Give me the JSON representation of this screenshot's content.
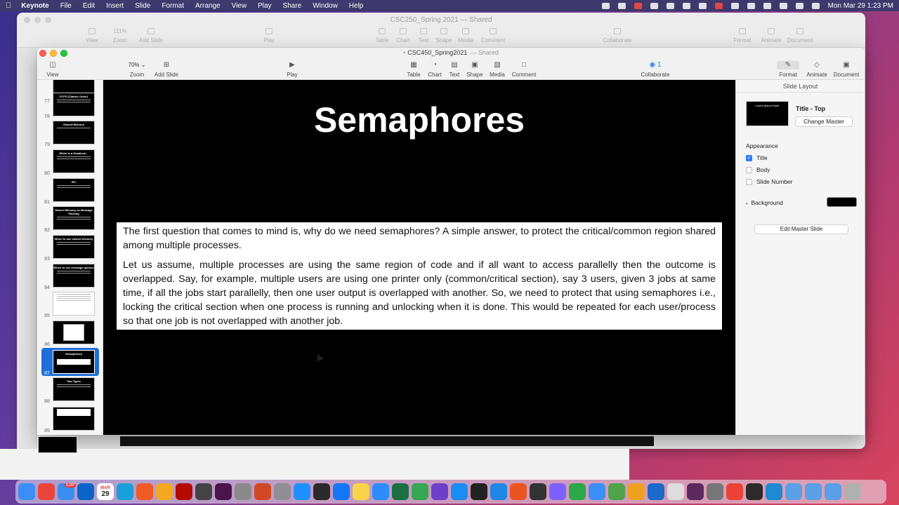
{
  "menubar": {
    "app_name": "Keynote",
    "items": [
      "File",
      "Edit",
      "Insert",
      "Slide",
      "Format",
      "Arrange",
      "View",
      "Play",
      "Share",
      "Window",
      "Help"
    ],
    "clock": "Mon Mar 29  1:23 PM"
  },
  "background_window": {
    "title": "CSC250_Spring 2021 — Shared",
    "toolbar": [
      "View",
      "Zoom",
      "Add Slide",
      "Play",
      "Table",
      "Chart",
      "Text",
      "Shape",
      "Media",
      "Comment",
      "Collaborate",
      "Format",
      "Animate",
      "Document"
    ],
    "zoom_value": "111%"
  },
  "window": {
    "title": "CSC450_Spring2021",
    "shared_label": "Shared",
    "toolbar": {
      "view": "View",
      "zoom_value": "70%",
      "zoom": "Zoom",
      "add_slide": "Add Slide",
      "play": "Play",
      "table": "Table",
      "chart": "Chart",
      "text": "Text",
      "shape": "Shape",
      "media": "Media",
      "comment": "Comment",
      "collab_count": "1",
      "collaborate": "Collaborate",
      "format": "Format",
      "animate": "Animate",
      "document": "Document"
    }
  },
  "navigator": {
    "slides": [
      {
        "number": "77",
        "title": ""
      },
      {
        "number": "78",
        "title": "FCFS (Classic Order)"
      },
      {
        "number": "79",
        "title": "Shared Memory"
      },
      {
        "number": "80",
        "title": "When is a Deadlock..."
      },
      {
        "number": "81",
        "title": "IPC"
      },
      {
        "number": "82",
        "title": "Shared Memory vs Message Passing"
      },
      {
        "number": "83",
        "title": "When to use shared memory"
      },
      {
        "number": "84",
        "title": "When to use message queues"
      },
      {
        "number": "85",
        "title": ""
      },
      {
        "number": "86",
        "title": ""
      },
      {
        "number": "87",
        "title": "Semaphores"
      },
      {
        "number": "88",
        "title": "Two Types"
      },
      {
        "number": "89",
        "title": ""
      }
    ],
    "selected_index": 10
  },
  "slide": {
    "title": "Semaphores",
    "paragraphs": [
      "The first question that comes to mind is, why do we need semaphores? A simple answer, to protect the critical/common region shared among multiple processes.",
      "Let us assume, multiple processes are using the same region of code and if all want to access parallelly then the outcome is overlapped. Say, for example, multiple users are using one printer only (common/critical section), say 3 users, given 3 jobs at same time, if all the jobs start parallelly, then one user output is overlapped with another. So, we need to protect that using semaphores i.e., locking the critical section when one process is running and unlocking when it is done. This would be repeated for each user/process so that one job is not overlapped with another job."
    ]
  },
  "inspector": {
    "header": "Slide Layout",
    "master_thumb_text": "Lorem Ipsum Dolor",
    "master_name": "Title - Top",
    "change_master": "Change Master",
    "appearance": "Appearance",
    "options": [
      {
        "label": "Title",
        "checked": true
      },
      {
        "label": "Body",
        "checked": false
      },
      {
        "label": "Slide Number",
        "checked": false
      }
    ],
    "background_label": "Background",
    "background_color": "#000000",
    "edit_master": "Edit Master Slide"
  },
  "colors": {
    "accent": "#2d7ff9",
    "selection": "#1f6fd8",
    "slide_bg": "#000000"
  },
  "dock": {
    "calendar_day": "29",
    "calendar_month": "MAR",
    "mail_badge": "1,147",
    "icons": [
      {
        "name": "finder",
        "color": "#3a8ef6"
      },
      {
        "name": "chrome",
        "color": "#e8453c"
      },
      {
        "name": "mail",
        "color": "#3b8ef0"
      },
      {
        "name": "outlook",
        "color": "#0a64c8"
      },
      {
        "name": "calendar",
        "color": "#ffffff"
      },
      {
        "name": "webex",
        "color": "#1aa0d8"
      },
      {
        "name": "brave",
        "color": "#f05a24"
      },
      {
        "name": "pages",
        "color": "#f5a623"
      },
      {
        "name": "acrobat",
        "color": "#b30b00"
      },
      {
        "name": "sublime",
        "color": "#444444"
      },
      {
        "name": "slack",
        "color": "#4a154b"
      },
      {
        "name": "launchpad",
        "color": "#8a8a8a"
      },
      {
        "name": "powerpoint",
        "color": "#d24726"
      },
      {
        "name": "settings",
        "color": "#8e8e93"
      },
      {
        "name": "safari",
        "color": "#1e90ff"
      },
      {
        "name": "epic-games",
        "color": "#2a2a2a"
      },
      {
        "name": "xcode",
        "color": "#1575f9"
      },
      {
        "name": "notes",
        "color": "#f7d44a"
      },
      {
        "name": "zoom",
        "color": "#2d8cff"
      },
      {
        "name": "excel",
        "color": "#1d6f42"
      },
      {
        "name": "chrome-2",
        "color": "#34a853"
      },
      {
        "name": "github",
        "color": "#6e40c9"
      },
      {
        "name": "app-store",
        "color": "#1c8cf5"
      },
      {
        "name": "terminal",
        "color": "#222222"
      },
      {
        "name": "windows",
        "color": "#1e88e5"
      },
      {
        "name": "ubuntu",
        "color": "#e95420"
      },
      {
        "name": "terminal-2",
        "color": "#333333"
      },
      {
        "name": "messenger",
        "color": "#7b61ff"
      },
      {
        "name": "numbers",
        "color": "#2aa84a"
      },
      {
        "name": "keynote",
        "color": "#3a8ef6"
      },
      {
        "name": "maps",
        "color": "#4fa34a"
      },
      {
        "name": "photos",
        "color": "#f0a020"
      },
      {
        "name": "sourcetree",
        "color": "#1b6ac9"
      },
      {
        "name": "textedit",
        "color": "#dddddd"
      },
      {
        "name": "slack-2",
        "color": "#5d2a5f"
      },
      {
        "name": "system-prefs",
        "color": "#777777"
      },
      {
        "name": "chrome-3",
        "color": "#ea4335"
      },
      {
        "name": "terminal-3",
        "color": "#2b2b2b"
      },
      {
        "name": "vscode",
        "color": "#1f8ad2"
      },
      {
        "name": "downloads",
        "color": "#5aa0e6"
      },
      {
        "name": "documents",
        "color": "#5aa0e6"
      },
      {
        "name": "folder",
        "color": "#5aa0e6"
      },
      {
        "name": "trash",
        "color": "#b0b0b0"
      }
    ]
  }
}
